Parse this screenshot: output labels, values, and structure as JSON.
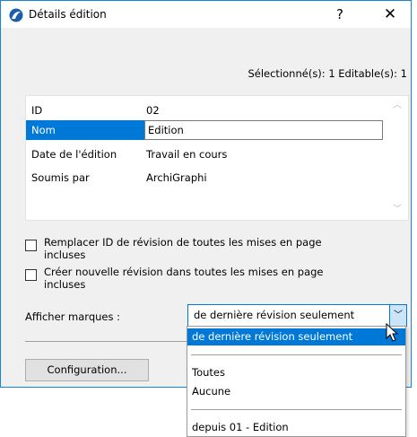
{
  "window": {
    "title": "Détails édition",
    "help": "?",
    "close": "✕"
  },
  "selection_info": "Sélectionné(s): 1 Editable(s): 1",
  "grid": {
    "rows": [
      {
        "key": "ID",
        "value": "02"
      },
      {
        "key": "Nom",
        "value": "Edition"
      },
      {
        "key": "Date de l'édition",
        "value": "Travail en cours"
      },
      {
        "key": "Soumis par",
        "value": "ArchiGraphi"
      }
    ]
  },
  "options": {
    "replace_id": {
      "label_1": "Remplacer ID de révision de toutes les mises en page",
      "label_2": "incluses",
      "checked": false
    },
    "new_revision": {
      "label_1": "Créer nouvelle révision dans toutes les mises en page",
      "label_2": "incluses",
      "checked": false
    }
  },
  "markers": {
    "label": "Afficher marques :",
    "selected": "de dernière révision seulement"
  },
  "dropdown": {
    "items": [
      "de dernière révision seulement",
      "Toutes",
      "Aucune",
      "depuis 01 - Edition"
    ]
  },
  "buttons": {
    "configuration": "Configuration..."
  },
  "colors": {
    "accent": "#0078d7",
    "border": "#1883d7"
  }
}
